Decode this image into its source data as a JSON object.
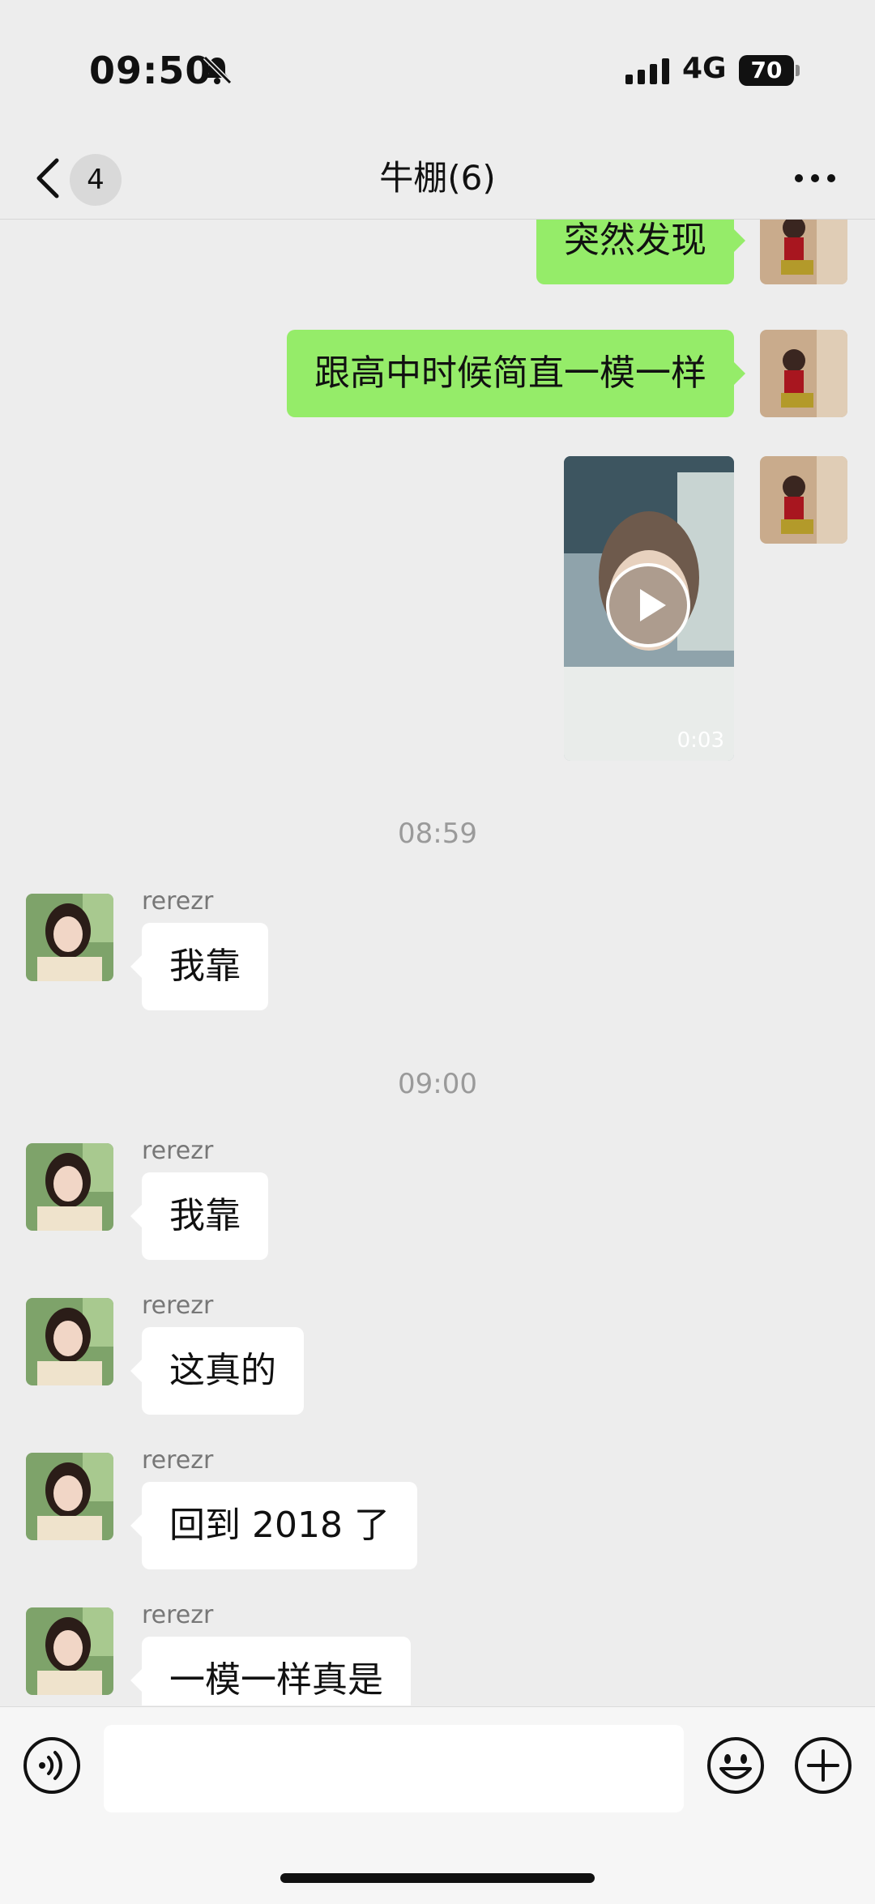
{
  "status_bar": {
    "time": "09:50",
    "network": "4G",
    "battery": "70",
    "icons": [
      "bell-muted-icon",
      "signal-icon"
    ]
  },
  "nav": {
    "back_icon": "chevron-left-icon",
    "unread_count": "4",
    "title": "牛棚(6)",
    "more_icon": "more-dots-icon"
  },
  "messages": {
    "me_1": "突然发现",
    "me_2": "跟高中时候简直一模一样",
    "me_video_duration": "0:03",
    "ts_1": "08:59",
    "them_1_sender": "rerezr",
    "them_1": "我靠",
    "ts_2": "09:00",
    "them_2_sender": "rerezr",
    "them_2": "我靠",
    "them_3_sender": "rerezr",
    "them_3": "这真的",
    "them_4_sender": "rerezr",
    "them_4": "回到 2018 了",
    "them_5_sender": "rerezr",
    "them_5": "一模一样真是"
  },
  "input_bar": {
    "placeholder": "",
    "icons": [
      "voice-icon",
      "emoji-icon",
      "plus-icon"
    ]
  },
  "colors": {
    "background": "#ededed",
    "my_bubble": "#95ec69",
    "their_bubble": "#ffffff"
  }
}
